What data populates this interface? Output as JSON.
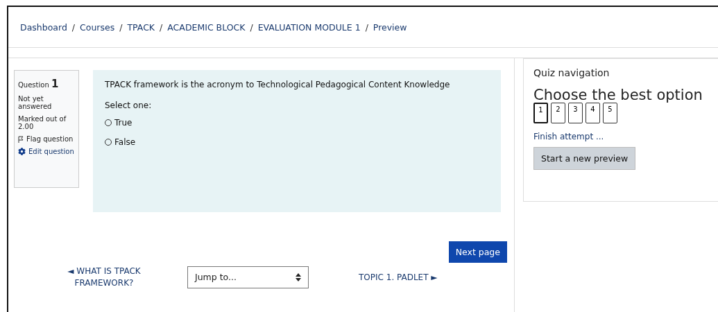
{
  "breadcrumb": [
    "Dashboard",
    "Courses",
    "TPACK",
    "ACADEMIC BLOCK",
    "EVALUATION MODULE 1",
    "Preview"
  ],
  "breadcrumb_separator": "/",
  "question_info": {
    "label": "Question",
    "number": "1",
    "status": "Not yet answered",
    "marks": "Marked out of 2.00",
    "flag": "Flag question",
    "edit": "Edit question"
  },
  "question": {
    "text": "TPACK framework is the acronym to Technological Pedagogical Content Knowledge",
    "prompt": "Select one:",
    "options": [
      {
        "label": "True",
        "checked": false
      },
      {
        "label": "False",
        "checked": false
      }
    ]
  },
  "next_button": "Next page",
  "prev_link": {
    "arrow": "◄",
    "label": "WHAT IS TPACK FRAMEWORK?"
  },
  "jump_select": {
    "value": "Jump to..."
  },
  "next_link": {
    "arrow": "►",
    "label": "TOPIC 1. PADLET"
  },
  "quiz_navigation": {
    "title": "Quiz navigation",
    "heading": "Choose the best option",
    "questions": [
      {
        "label": "1",
        "selected": true
      },
      {
        "label": "2",
        "selected": false
      },
      {
        "label": "3",
        "selected": false
      },
      {
        "label": "4",
        "selected": false
      },
      {
        "label": "5",
        "selected": false
      }
    ],
    "finish": "Finish attempt ...",
    "new_preview": "Start a new preview"
  }
}
